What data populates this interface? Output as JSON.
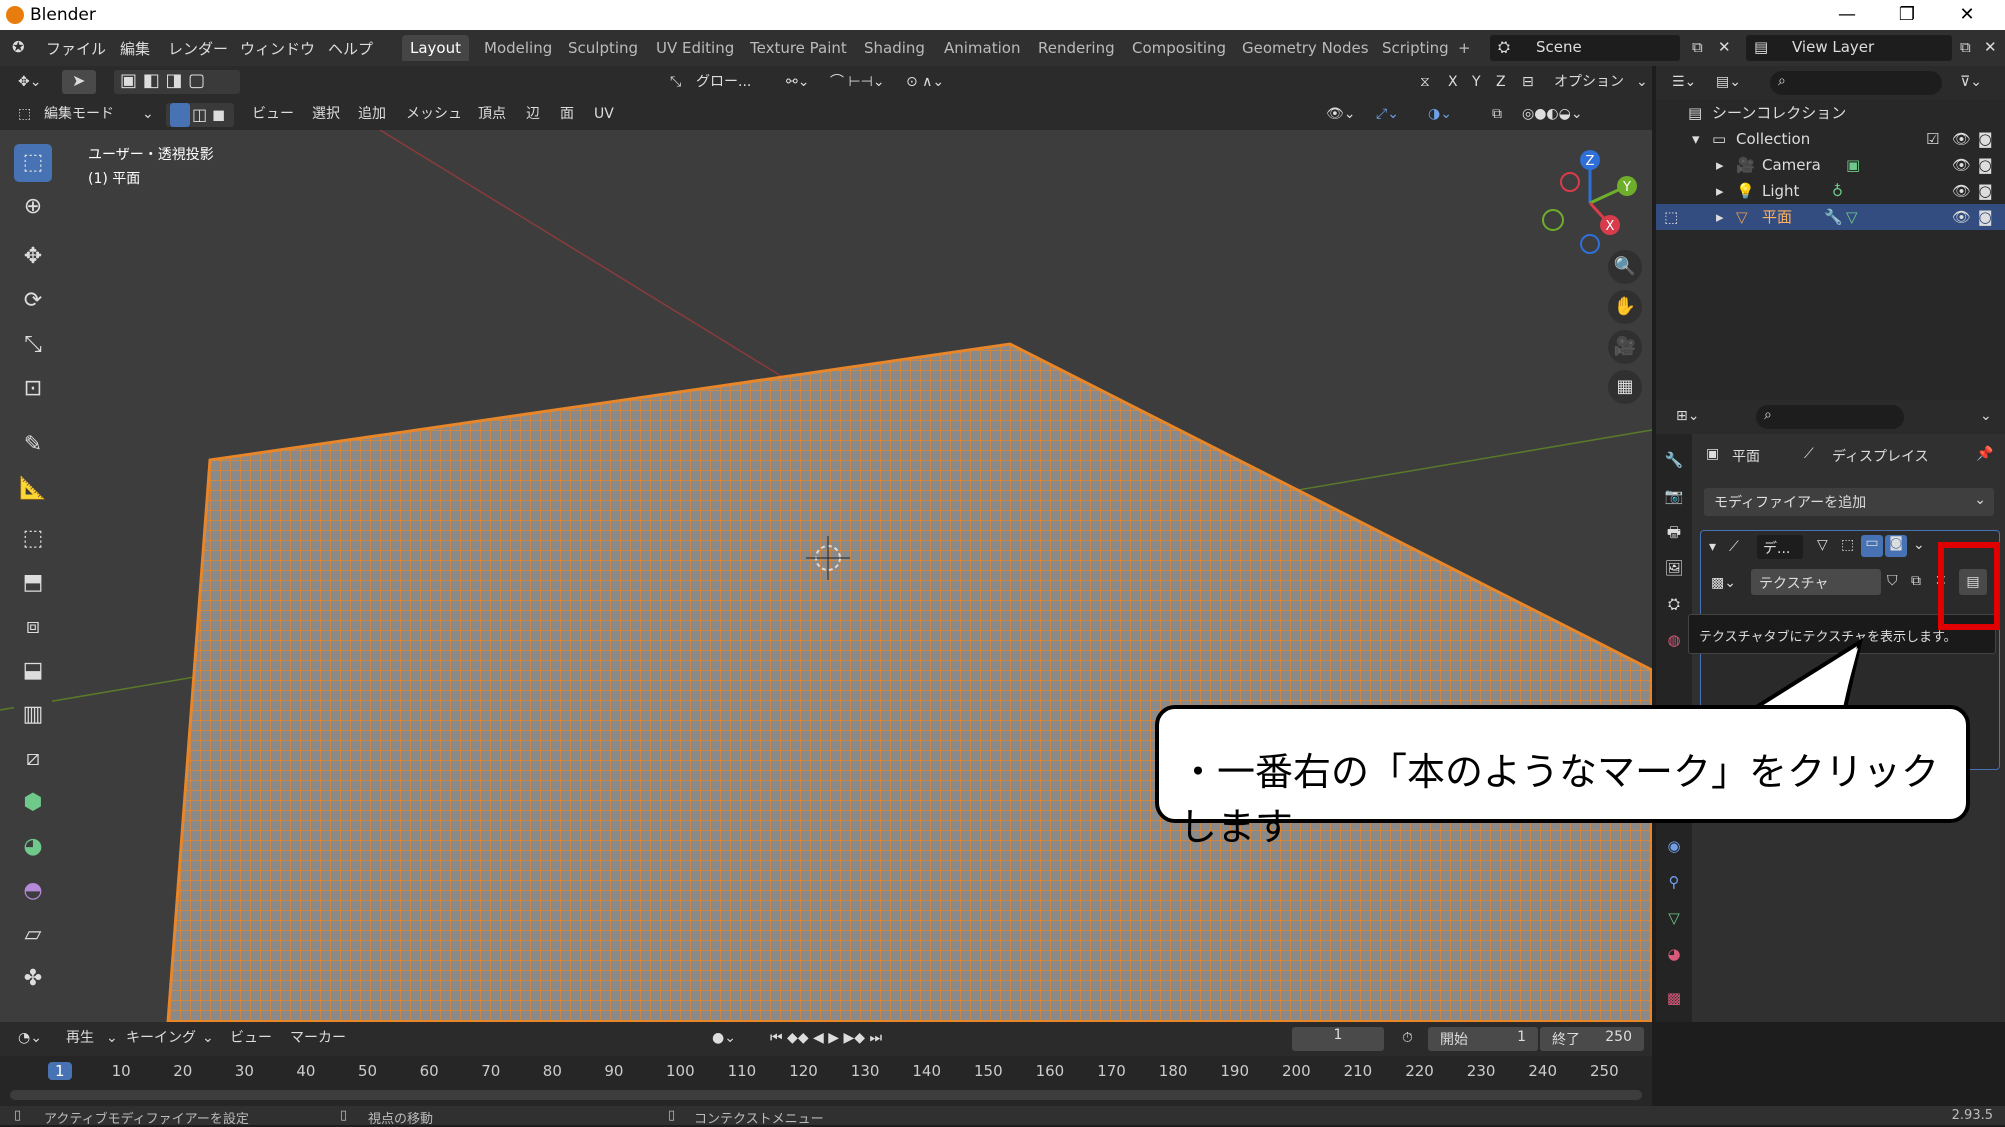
{
  "window": {
    "title": "Blender"
  },
  "menubar": {
    "items": [
      "ファイル",
      "編集",
      "レンダー",
      "ウィンドウ",
      "ヘルプ"
    ],
    "workspaces": [
      "Layout",
      "Modeling",
      "Sculpting",
      "UV Editing",
      "Texture Paint",
      "Shading",
      "Animation",
      "Rendering",
      "Compositing",
      "Geometry Nodes",
      "Scripting"
    ],
    "add_tab": "+",
    "scene": "Scene",
    "view_layer": "View Layer"
  },
  "viewport_header": {
    "transform_orientation": "グロー...",
    "options": "オプション",
    "axes": [
      "X",
      "Y",
      "Z"
    ],
    "mode": "編集モード",
    "menus": [
      "ビュー",
      "選択",
      "追加",
      "メッシュ",
      "頂点",
      "辺",
      "面",
      "UV"
    ]
  },
  "viewport": {
    "view_label": "ユーザー・透視投影",
    "object_label": "(1) 平面",
    "gizmo": {
      "x": "X",
      "y": "Y",
      "z": "Z"
    }
  },
  "outliner": {
    "root": "シーンコレクション",
    "collection": "Collection",
    "items": [
      {
        "name": "Camera"
      },
      {
        "name": "Light"
      },
      {
        "name": "平面"
      }
    ]
  },
  "properties": {
    "breadcrumb_object": "平面",
    "breadcrumb_modifier": "ディスプレイス",
    "add_modifier": "モディファイアーを追加",
    "modifier_name": "デ...",
    "texture_label": "テクスチャ",
    "tooltip": "テクスチャタブにテクスチャを表示します。"
  },
  "timeline": {
    "menus": [
      "再生",
      "キーイング",
      "ビュー",
      "マーカー"
    ],
    "current_frame": "1",
    "start_label": "開始",
    "start": "1",
    "end_label": "終了",
    "end": "250",
    "ticks": [
      "1",
      "10",
      "20",
      "30",
      "40",
      "50",
      "60",
      "70",
      "80",
      "90",
      "100",
      "110",
      "120",
      "130",
      "140",
      "150",
      "160",
      "170",
      "180",
      "190",
      "200",
      "210",
      "220",
      "230",
      "240",
      "250"
    ]
  },
  "statusbar": {
    "left": "アクティブモディファイアーを設定",
    "middle": "視点の移動",
    "right_action": "コンテクストメニュー",
    "version": "2.93.5"
  },
  "callout": {
    "text": "・一番右の「本のようなマーク」をクリックします"
  },
  "colors": {
    "accent": "#4772b3",
    "mesh": "#e8862a",
    "highlight": "#e00000"
  }
}
